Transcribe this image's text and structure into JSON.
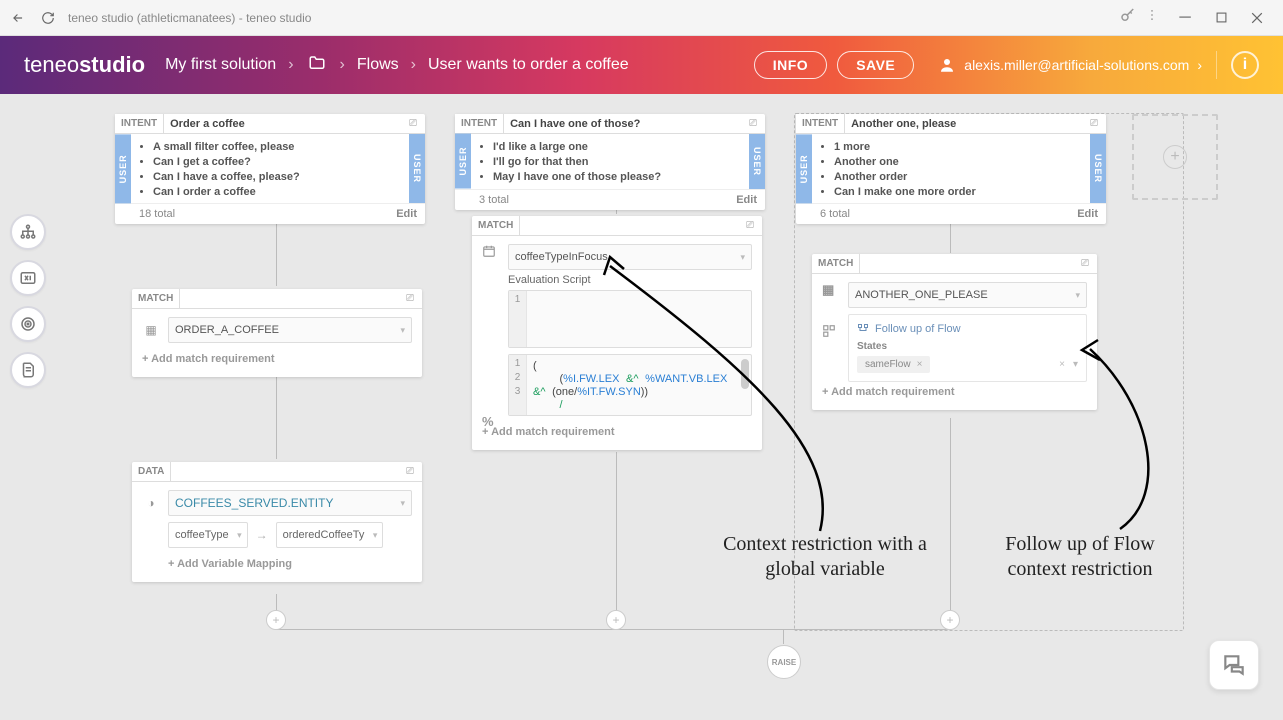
{
  "titlebar": {
    "title": "teneo studio (athleticmanatees) - teneo studio"
  },
  "header": {
    "logo_light": "teneo",
    "logo_bold": "studio",
    "crumb_solution": "My first solution",
    "crumb_flows": "Flows",
    "crumb_current": "User wants to order a coffee",
    "btn_info": "INFO",
    "btn_save": "SAVE",
    "user": "alexis.miller@artificial-solutions.com"
  },
  "cards": {
    "intent1": {
      "tag": "INTENT",
      "title": "Order a coffee",
      "items": [
        "A small filter coffee, please",
        "Can I get a coffee?",
        "Can I have a coffee, please?",
        "Can I order a coffee"
      ],
      "total": "18 total",
      "edit": "Edit",
      "user": "USER"
    },
    "intent2": {
      "tag": "INTENT",
      "title": "Can I have one of those?",
      "items": [
        "I'd like a large one",
        "I'll go for that then",
        "May I have one of those please?"
      ],
      "total": "3 total",
      "edit": "Edit",
      "user": "USER"
    },
    "intent3": {
      "tag": "INTENT",
      "title": "Another one, please",
      "items": [
        "1 more",
        "Another one",
        "Another order",
        "Can I make one more order"
      ],
      "total": "6 total",
      "edit": "Edit",
      "user": "USER"
    },
    "match1": {
      "tag": "MATCH",
      "value": "ORDER_A_COFFEE",
      "add": "+ Add match requirement"
    },
    "match2": {
      "tag": "MATCH",
      "focus_value": "coffeeTypeInFocus",
      "eval_label": "Evaluation Script",
      "code_lines": [
        "(",
        "    (%I.FW.LEX &^ %WANT.VB.LEX &^ (one/%IT.FW.SYN))",
        "    /"
      ],
      "add": "+ Add match requirement"
    },
    "match3": {
      "tag": "MATCH",
      "value": "ANOTHER_ONE_PLEASE",
      "followup_label": "Follow up of Flow",
      "states_label": "States",
      "chip": "sameFlow",
      "add": "+ Add match requirement"
    },
    "data1": {
      "tag": "DATA",
      "entity": "COFFEES_SERVED.ENTITY",
      "map_from": "coffeeType",
      "map_to": "orderedCoffeeTy",
      "add_var": "+ Add Variable Mapping"
    }
  },
  "raise": "RAISE",
  "annotations": {
    "a1": "Context restriction with a global variable",
    "a2": "Follow up of Flow context restriction"
  }
}
